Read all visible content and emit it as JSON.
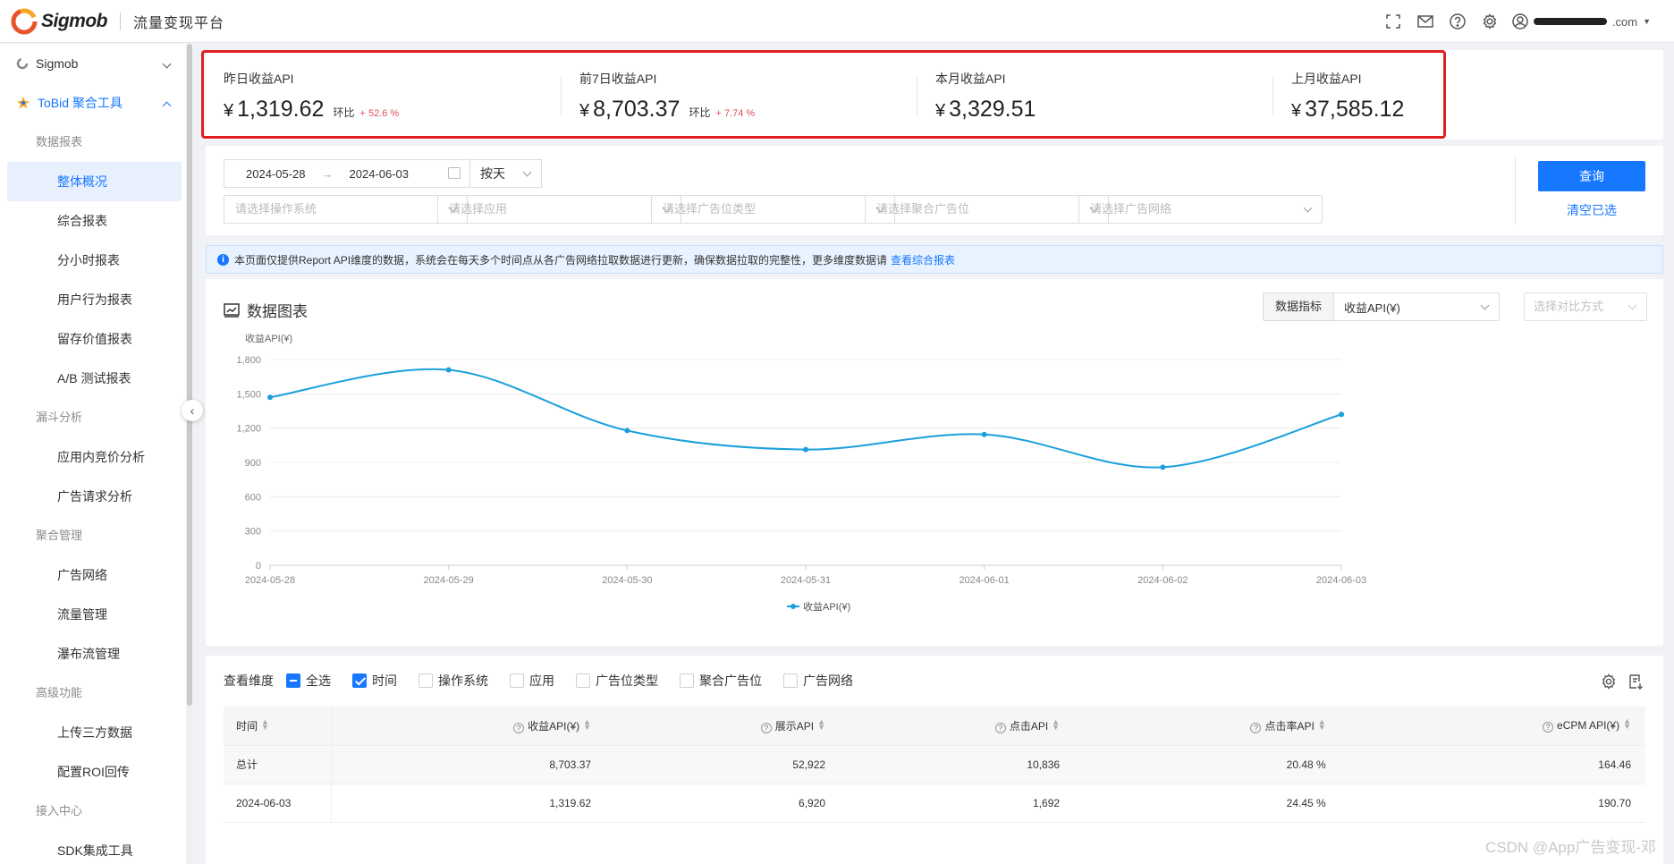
{
  "header": {
    "logo_text": "Sigmob",
    "platform_name": "流量变现平台",
    "user_suffix": ".com"
  },
  "sidebar": {
    "top_items": [
      {
        "label": "Sigmob"
      },
      {
        "label": "ToBid 聚合工具"
      }
    ],
    "groups": [
      {
        "title": "数据报表",
        "items": [
          "整体概况",
          "综合报表",
          "分小时报表",
          "用户行为报表",
          "留存价值报表",
          "A/B 测试报表"
        ]
      },
      {
        "title": "漏斗分析",
        "items": [
          "应用内竞价分析",
          "广告请求分析"
        ]
      },
      {
        "title": "聚合管理",
        "items": [
          "广告网络",
          "流量管理",
          "瀑布流管理"
        ]
      },
      {
        "title": "高级功能",
        "items": [
          "上传三方数据",
          "配置ROI回传"
        ]
      },
      {
        "title": "接入中心",
        "items": [
          "SDK集成工具"
        ]
      }
    ]
  },
  "kpis": [
    {
      "title": "昨日收益API",
      "currency": "¥",
      "value": "1,319.62",
      "ratio_label": "环比",
      "ratio": "+ 52.6 %"
    },
    {
      "title": "前7日收益API",
      "currency": "¥",
      "value": "8,703.37",
      "ratio_label": "环比",
      "ratio": "+ 7.74 %"
    },
    {
      "title": "本月收益API",
      "currency": "¥",
      "value": "3,329.51"
    },
    {
      "title": "上月收益API",
      "currency": "¥",
      "value": "37,585.12"
    }
  ],
  "filters": {
    "date_start": "2024-05-28",
    "date_end": "2024-06-03",
    "granularity": "按天",
    "selects": [
      "请选择操作系统",
      "请选择应用",
      "请选择广告位类型",
      "请选择聚合广告位",
      "请选择广告网络"
    ],
    "query_label": "查询",
    "clear_label": "清空已选"
  },
  "notice": {
    "text": "本页面仅提供Report API维度的数据，系统会在每天多个时间点从各广告网络拉取数据进行更新，确保数据拉取的完整性，更多维度数据请",
    "link": "查看综合报表"
  },
  "chart_panel": {
    "title": "数据图表",
    "metric_label": "数据指标",
    "metric_value": "收益API(¥)",
    "compare_placeholder": "选择对比方式"
  },
  "chart_data": {
    "type": "line",
    "ylabel": "收益API(¥)",
    "x": [
      "2024-05-28",
      "2024-05-29",
      "2024-05-30",
      "2024-05-31",
      "2024-06-01",
      "2024-06-02",
      "2024-06-03"
    ],
    "yticks": [
      0,
      300,
      600,
      900,
      1200,
      1500,
      1800
    ],
    "ytick_labels": [
      "0",
      "300",
      "600",
      "900",
      "1,200",
      "1,500",
      "1,800"
    ],
    "ylim": [
      0,
      1800
    ],
    "series": [
      {
        "name": "收益API(¥)",
        "color": "#1aa0dc",
        "values": [
          1469.6,
          1710.1,
          1178.6,
          1012.9,
          1144.4,
          858.1,
          1319.62
        ]
      }
    ],
    "grid": true,
    "legend": "bottom-center"
  },
  "table": {
    "dimension_label": "查看维度",
    "checkboxes": [
      {
        "label": "全选",
        "state": "indeterminate"
      },
      {
        "label": "时间",
        "state": "checked"
      },
      {
        "label": "操作系统",
        "state": "unchecked"
      },
      {
        "label": "应用",
        "state": "unchecked"
      },
      {
        "label": "广告位类型",
        "state": "unchecked"
      },
      {
        "label": "聚合广告位",
        "state": "unchecked"
      },
      {
        "label": "广告网络",
        "state": "unchecked"
      }
    ],
    "columns": [
      "时间",
      "收益API(¥)",
      "展示API",
      "点击API",
      "点击率API",
      "eCPM API(¥)"
    ],
    "rows": [
      [
        "总计",
        "8,703.37",
        "52,922",
        "10,836",
        "20.48 %",
        "164.46"
      ],
      [
        "2024-06-03",
        "1,319.62",
        "6,920",
        "1,692",
        "24.45 %",
        "190.70"
      ]
    ]
  },
  "watermark": "CSDN @App广告变现-邓"
}
